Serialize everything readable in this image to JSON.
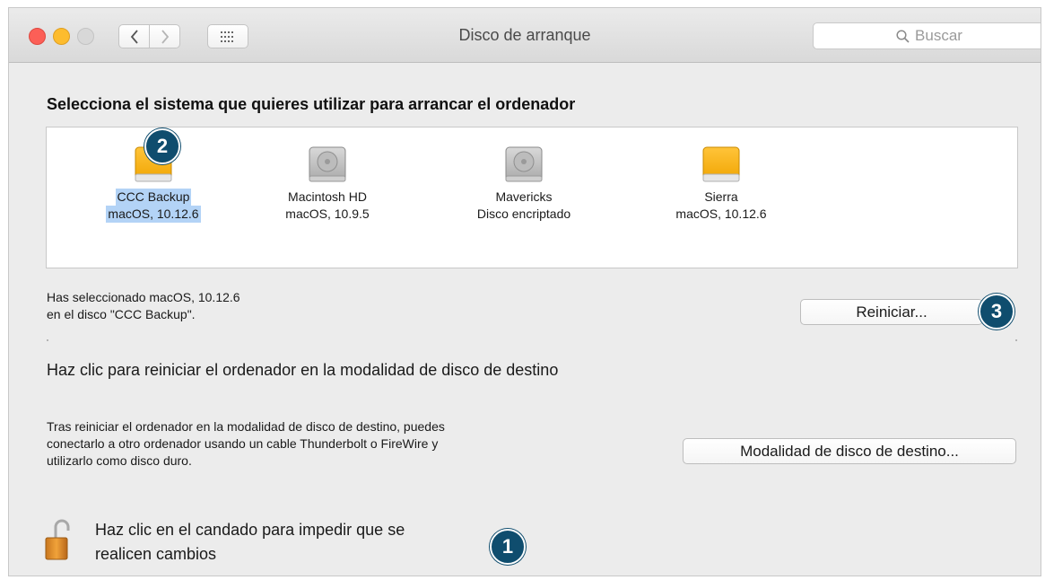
{
  "window": {
    "title": "Disco de arranque",
    "search_placeholder": "Buscar"
  },
  "heading": "Selecciona el sistema que quieres utilizar para arrancar el ordenador",
  "disks": [
    {
      "name": "CCC Backup",
      "detail": "macOS, 10.12.6",
      "icon": "orange-drive-icon",
      "selected": true
    },
    {
      "name": "Macintosh HD",
      "detail": "macOS, 10.9.5",
      "icon": "gray-drive-icon",
      "selected": false
    },
    {
      "name": "Mavericks",
      "detail": "Disco encriptado",
      "icon": "gray-drive-icon",
      "selected": false
    },
    {
      "name": "Sierra",
      "detail": "macOS, 10.12.6",
      "icon": "orange-drive-icon",
      "selected": false
    }
  ],
  "selection": {
    "line1": "Has seleccionado macOS, 10.12.6",
    "line2": "en el disco \"CCC Backup\"."
  },
  "restart_button": "Reiniciar...",
  "target_mode": {
    "heading": "Haz clic para reiniciar el ordenador en la modalidad de disco de destino",
    "desc_line1": "Tras reiniciar el ordenador en la modalidad de disco de destino, puedes",
    "desc_line2": "conectarlo a otro ordenador usando un cable Thunderbolt o FireWire y",
    "desc_line3": "utilizarlo como disco duro.",
    "button": "Modalidad de disco de destino..."
  },
  "lock": {
    "line1": "Haz clic en el candado para impedir que se",
    "line2": "realicen cambios"
  },
  "badges": {
    "one": "1",
    "two": "2",
    "three": "3"
  },
  "colors": {
    "accent_badge": "#0f4d6e",
    "selection_highlight": "#b3d3f6",
    "close": "#fc5f57",
    "minimize": "#fdbc2e"
  }
}
